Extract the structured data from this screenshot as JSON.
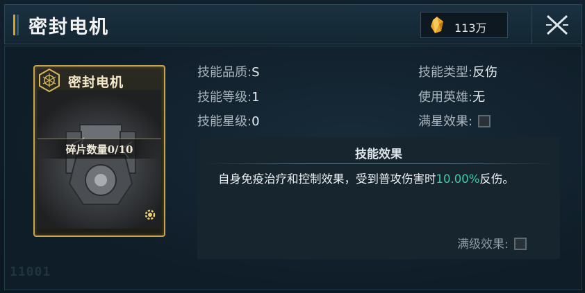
{
  "header": {
    "title": "密封电机",
    "currency_value": "113万",
    "currency_icon": "crystal-icon",
    "close_icon": "close-icon"
  },
  "card": {
    "name": "密封电机",
    "fragment_count": "碎片数量0/10",
    "badge_icon": "hexagon-emblem-icon",
    "gear_icon": "gear-icon"
  },
  "attributes": {
    "quality_label": "技能品质:",
    "quality_value": "S",
    "level_label": "技能等级:",
    "level_value": "1",
    "star_label": "技能星级:",
    "star_value": "0",
    "type_label": "技能类型:",
    "type_value": "反伤",
    "hero_label": "使用英雄:",
    "hero_value": "无",
    "max_star_label": "满星效果:"
  },
  "effect": {
    "title": "技能效果",
    "text_before": "自身免疫治疗和控制效果，受到普攻伤害时",
    "highlight": "10.00%",
    "text_after": "反伤。",
    "max_level_label": "满级效果:"
  },
  "watermark": "11001",
  "colors": {
    "accent_gold": "#caa64a",
    "highlight_green": "#3fc9a6",
    "panel_bg": "#0f1d28"
  }
}
